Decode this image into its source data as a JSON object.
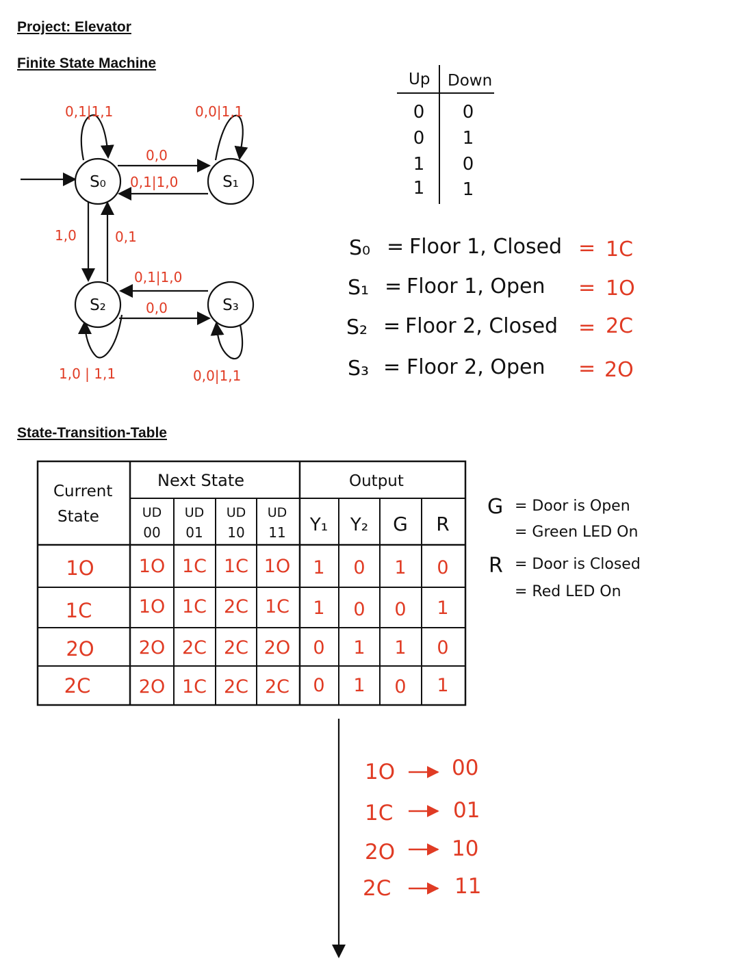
{
  "headings": {
    "project": "Project: Elevator",
    "fsm": "Finite State Machine",
    "stt": "State-Transition-Table"
  },
  "colors": {
    "ink": "#111111",
    "accent": "#e03b24"
  },
  "fsm": {
    "states": {
      "s0": "S₀",
      "s1": "S₁",
      "s2": "S₂",
      "s3": "S₃"
    },
    "transitions": {
      "s0_self": "0,1|1,1",
      "s1_self": "0,0|1,1",
      "s0_to_s1": "0,0",
      "s1_to_s0": "0,1|1,0",
      "s0_to_s2": "1,0",
      "s2_to_s0": "0,1",
      "s3_to_s2": "0,1|1,0",
      "s2_to_s3": "0,0",
      "s2_self": "1,0 | 1,1",
      "s3_self": "0,0|1,1"
    }
  },
  "input_table": {
    "headers": [
      "Up",
      "Down"
    ],
    "rows": [
      [
        "0",
        "0"
      ],
      [
        "0",
        "1"
      ],
      [
        "1",
        "0"
      ],
      [
        "1",
        "1"
      ]
    ]
  },
  "state_definitions": [
    {
      "state": "S₀",
      "eq": "=",
      "desc": "Floor 1, Closed",
      "eq2": "=",
      "code": "1C"
    },
    {
      "state": "S₁",
      "eq": "=",
      "desc": "Floor 1, Open",
      "eq2": "=",
      "code": "1O"
    },
    {
      "state": "S₂",
      "eq": "=",
      "desc": "Floor 2, Closed",
      "eq2": "=",
      "code": "2C"
    },
    {
      "state": "S₃",
      "eq": "=",
      "desc": "Floor 2, Open",
      "eq2": "=",
      "code": "2O"
    }
  ],
  "transition_table": {
    "col_current": [
      "Current",
      "State"
    ],
    "col_next": "Next State",
    "col_output": "Output",
    "ud_label": "UD",
    "ud_codes": [
      "00",
      "01",
      "10",
      "11"
    ],
    "output_cols": {
      "y1": "Y₁",
      "y2": "Y₂",
      "g": "G",
      "r": "R"
    },
    "rows": [
      {
        "current": "1O",
        "next": [
          "1O",
          "1C",
          "1C",
          "1O"
        ],
        "out": [
          "1",
          "0",
          "1",
          "0"
        ]
      },
      {
        "current": "1C",
        "next": [
          "1O",
          "1C",
          "2C",
          "1C"
        ],
        "out": [
          "1",
          "0",
          "0",
          "1"
        ]
      },
      {
        "current": "2O",
        "next": [
          "2O",
          "2C",
          "2C",
          "2O"
        ],
        "out": [
          "0",
          "1",
          "1",
          "0"
        ]
      },
      {
        "current": "2C",
        "next": [
          "2O",
          "1C",
          "2C",
          "2C"
        ],
        "out": [
          "0",
          "1",
          "0",
          "1"
        ]
      }
    ]
  },
  "legend": {
    "g_letter": "G",
    "g_line1": "= Door is Open",
    "g_line2": "= Green LED On",
    "r_letter": "R",
    "r_line1": "= Door is Closed",
    "r_line2": "= Red LED On"
  },
  "encoding": [
    {
      "from": "1O",
      "to": "00"
    },
    {
      "from": "1C",
      "to": "01"
    },
    {
      "from": "2O",
      "to": "10"
    },
    {
      "from": "2C",
      "to": "11"
    }
  ]
}
